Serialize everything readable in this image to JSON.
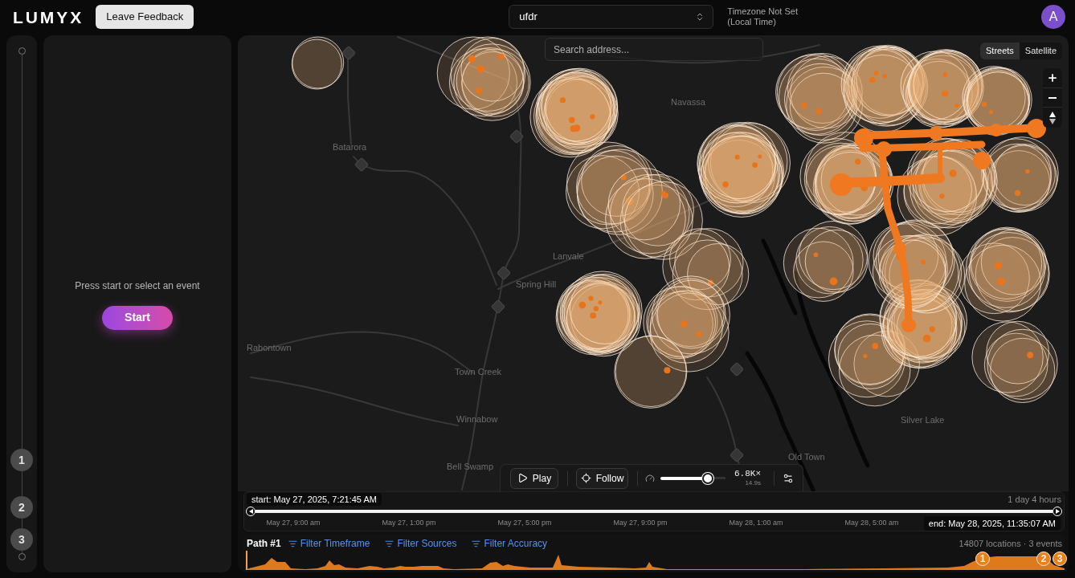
{
  "header": {
    "logo": "LUMYX",
    "feedback_button": "Leave Feedback",
    "dataset_select": {
      "value": "ufdr"
    },
    "timezone": [
      "Timezone Not Set",
      "(Local Time)"
    ],
    "avatar": "A"
  },
  "event_rail": {
    "events": [
      {
        "label": "1"
      },
      {
        "label": "2"
      },
      {
        "label": "3"
      }
    ]
  },
  "side_panel": {
    "message": "Press start or select an event",
    "start_button": "Start"
  },
  "map": {
    "search": {
      "placeholder": "Search address..."
    },
    "layers": [
      {
        "label": "Streets",
        "selected": true
      },
      {
        "label": "Satellite",
        "selected": false
      }
    ],
    "place_labels": [
      "Navassa",
      "Batarora",
      "Lanvale",
      "Spring Hill",
      "Rabontown",
      "Town Creek",
      "Winnabow",
      "Bell Swamp",
      "Old Town",
      "Silver Lake"
    ]
  },
  "playback": {
    "play_button": "Play",
    "follow_button": "Follow",
    "speed": {
      "level": 0.73,
      "multiplier": "6.8K×",
      "duration": "14.9s"
    }
  },
  "timeline": {
    "start": "start: May 27, 2025, 7:21:45 AM",
    "duration": "1 day 4 hours",
    "ticks": [
      "May 27, 9:00 am",
      "May 27, 1:00 pm",
      "May 27, 5:00 pm",
      "May 27, 9:00 pm",
      "May 28, 1:00 am",
      "May 28, 5:00 am"
    ],
    "end": "end: May 28, 2025, 11:35:07 AM"
  },
  "path": {
    "title": "Path #1",
    "filters": [
      "Filter Timeframe",
      "Filter Sources",
      "Filter Accuracy"
    ],
    "summary": "14807 locations · 3 events",
    "event_markers": [
      {
        "label": "1"
      },
      {
        "label": "2"
      },
      {
        "label": "3"
      }
    ]
  }
}
